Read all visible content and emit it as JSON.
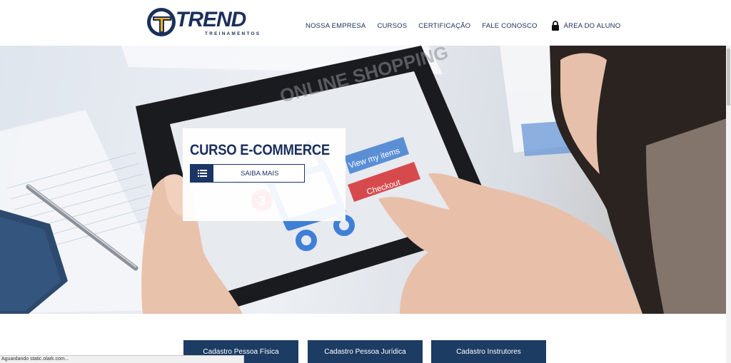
{
  "brand": {
    "name": "TREND",
    "tagline": "TREINAMENTOS",
    "colors": {
      "navy": "#1b2f5c",
      "gold": "#f5b21c",
      "button_blue": "#1d3c64"
    }
  },
  "nav": {
    "items": [
      {
        "label": "NOSSA EMPRESA"
      },
      {
        "label": "CURSOS"
      },
      {
        "label": "CERTIFICAÇÃO"
      },
      {
        "label": "FALE CONOSCO"
      }
    ],
    "aluno": {
      "label": "ÁREA DO ALUNO",
      "icon": "lock-icon"
    }
  },
  "hero": {
    "title": "CURSO E-COMMERCE",
    "button_label": "SAIBA MAIS",
    "button_icon": "list-icon",
    "tablet_text": {
      "heading": "ONLINE SHOPPING",
      "view_items": "View my items",
      "checkout": "Checkout",
      "cart_count": "3"
    }
  },
  "registration": {
    "buttons": [
      {
        "label": "Cadastro Pessoa Física"
      },
      {
        "label": "Cadastro Pessoa Jurídica"
      },
      {
        "label": "Cadastro Instrutores"
      }
    ]
  },
  "status_bar": {
    "text": "Aguardando static.olark.com..."
  }
}
